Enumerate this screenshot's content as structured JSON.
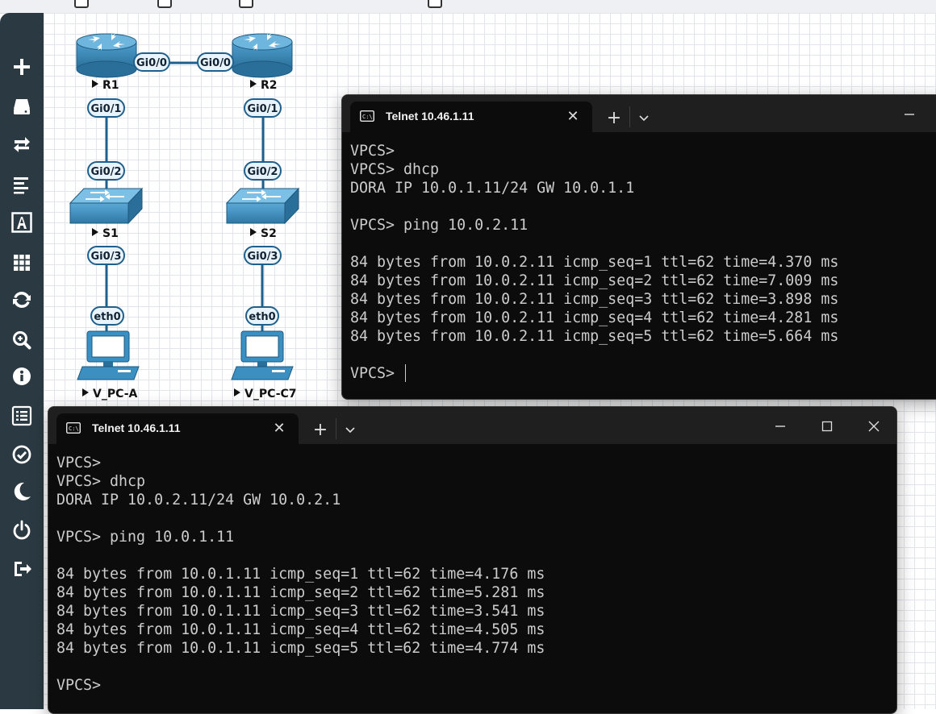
{
  "sidebar": {
    "icons": [
      "plus-icon",
      "hard-drive-icon",
      "swap-arrows-icon",
      "align-left-icon",
      "text-a-icon",
      "grid-icon",
      "refresh-icon",
      "zoom-in-icon",
      "info-icon",
      "list-icon",
      "check-circle-icon",
      "moon-icon",
      "power-icon",
      "logout-icon"
    ]
  },
  "topology": {
    "nodes": {
      "r1": "R1",
      "r2": "R2",
      "s1": "S1",
      "s2": "S2",
      "pc_a": "V_PC-A",
      "pc_c7": "V_PC-C7"
    },
    "ports": {
      "r1_gi00": "Gi0/0",
      "r2_gi00": "Gi0/0",
      "r1_gi01": "Gi0/1",
      "r2_gi01": "Gi0/1",
      "s1_gi02": "Gi0/2",
      "s2_gi02": "Gi0/2",
      "s1_gi03": "Gi0/3",
      "s2_gi03": "Gi0/3",
      "pc_a_eth0": "eth0",
      "pc_c7_eth0": "eth0"
    },
    "link_color": "#1f5f8b"
  },
  "terminal_top": {
    "tab_title": "Telnet 10.46.1.11",
    "lines": [
      "VPCS>",
      "VPCS> dhcp",
      "DORA IP 10.0.1.11/24 GW 10.0.1.1",
      "",
      "VPCS> ping 10.0.2.11",
      "",
      "84 bytes from 10.0.2.11 icmp_seq=1 ttl=62 time=4.370 ms",
      "84 bytes from 10.0.2.11 icmp_seq=2 ttl=62 time=7.009 ms",
      "84 bytes from 10.0.2.11 icmp_seq=3 ttl=62 time=3.898 ms",
      "84 bytes from 10.0.2.11 icmp_seq=4 ttl=62 time=4.281 ms",
      "84 bytes from 10.0.2.11 icmp_seq=5 ttl=62 time=5.664 ms",
      "",
      "VPCS> "
    ]
  },
  "terminal_bottom": {
    "tab_title": "Telnet 10.46.1.11",
    "lines": [
      "VPCS>",
      "VPCS> dhcp",
      "DORA IP 10.0.2.11/24 GW 10.0.2.1",
      "",
      "VPCS> ping 10.0.1.11",
      "",
      "84 bytes from 10.0.1.11 icmp_seq=1 ttl=62 time=4.176 ms",
      "84 bytes from 10.0.1.11 icmp_seq=2 ttl=62 time=5.281 ms",
      "84 bytes from 10.0.1.11 icmp_seq=3 ttl=62 time=3.541 ms",
      "84 bytes from 10.0.1.11 icmp_seq=4 ttl=62 time=4.505 ms",
      "84 bytes from 10.0.1.11 icmp_seq=5 ttl=62 time=4.774 ms",
      "",
      "VPCS>"
    ]
  }
}
